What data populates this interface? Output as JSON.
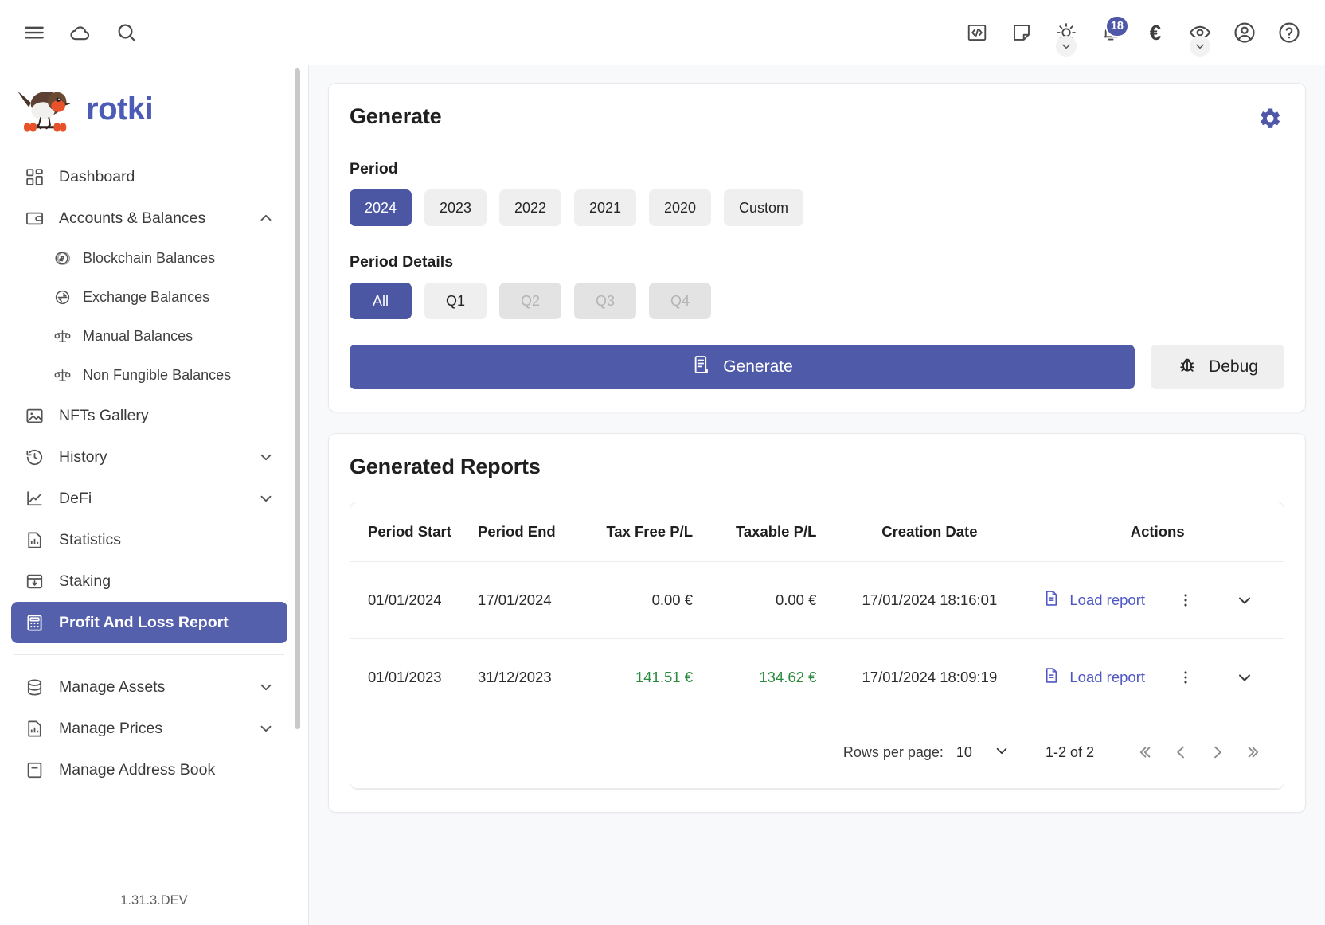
{
  "topbar": {
    "icons": [
      {
        "name": "menu-icon",
        "label": "Menu"
      },
      {
        "name": "cloud-icon",
        "label": "Cloud sync"
      },
      {
        "name": "search-icon",
        "label": "Search"
      }
    ],
    "right_icons": [
      {
        "name": "code-icon",
        "label": "Developer"
      },
      {
        "name": "note-icon",
        "label": "Notes"
      },
      {
        "name": "sun-icon",
        "label": "Theme"
      },
      {
        "name": "bell-icon",
        "label": "Notifications"
      },
      {
        "name": "euro-icon",
        "label": "Currency"
      },
      {
        "name": "eye-icon",
        "label": "Privacy mode"
      },
      {
        "name": "account-icon",
        "label": "Account"
      },
      {
        "name": "help-icon",
        "label": "Help"
      }
    ],
    "notification_count": "18",
    "currency_symbol": "€"
  },
  "brand": {
    "name": "rotki",
    "color": "#4c5bb5"
  },
  "sidebar": {
    "version": "1.31.3.DEV",
    "items": [
      {
        "label": "Dashboard",
        "icon": "dashboard-icon",
        "level": "top",
        "expandable": false,
        "active": false
      },
      {
        "label": "Accounts & Balances",
        "icon": "wallet-icon",
        "level": "top",
        "expandable": true,
        "expanded": true,
        "active": false
      },
      {
        "label": "Blockchain Balances",
        "icon": "coin-icon",
        "level": "sub",
        "expandable": false,
        "active": false
      },
      {
        "label": "Exchange Balances",
        "icon": "exchange-icon",
        "level": "sub",
        "expandable": false,
        "active": false
      },
      {
        "label": "Manual Balances",
        "icon": "scale-icon",
        "level": "sub",
        "expandable": false,
        "active": false
      },
      {
        "label": "Non Fungible Balances",
        "icon": "scale-icon",
        "level": "sub",
        "expandable": false,
        "active": false
      },
      {
        "label": "NFTs Gallery",
        "icon": "image-icon",
        "level": "top",
        "expandable": false,
        "active": false
      },
      {
        "label": "History",
        "icon": "history-icon",
        "level": "top",
        "expandable": true,
        "expanded": false,
        "active": false
      },
      {
        "label": "DeFi",
        "icon": "chart-line-icon",
        "level": "top",
        "expandable": true,
        "expanded": false,
        "active": false
      },
      {
        "label": "Statistics",
        "icon": "bar-chart-icon",
        "level": "top",
        "expandable": false,
        "active": false
      },
      {
        "label": "Staking",
        "icon": "staking-icon",
        "level": "top",
        "expandable": false,
        "active": false
      },
      {
        "label": "Profit And Loss Report",
        "icon": "calculator-icon",
        "level": "top",
        "expandable": false,
        "active": true
      },
      {
        "label": "Manage Assets",
        "icon": "database-icon",
        "level": "top",
        "expandable": true,
        "expanded": false,
        "active": false
      },
      {
        "label": "Manage Prices",
        "icon": "price-chart-icon",
        "level": "top",
        "expandable": true,
        "expanded": false,
        "active": false
      },
      {
        "label": "Manage Address Book",
        "icon": "address-book-icon",
        "level": "top",
        "expandable": false,
        "active": false
      }
    ]
  },
  "generate_card": {
    "title": "Generate",
    "settings_icon": "gear-icon",
    "period_label": "Period",
    "periods": [
      {
        "label": "2024",
        "active": true,
        "disabled": false
      },
      {
        "label": "2023",
        "active": false,
        "disabled": false
      },
      {
        "label": "2022",
        "active": false,
        "disabled": false
      },
      {
        "label": "2021",
        "active": false,
        "disabled": false
      },
      {
        "label": "2020",
        "active": false,
        "disabled": false
      },
      {
        "label": "Custom",
        "active": false,
        "disabled": false
      }
    ],
    "period_details_label": "Period Details",
    "period_details": [
      {
        "label": "All",
        "active": true,
        "disabled": false
      },
      {
        "label": "Q1",
        "active": false,
        "disabled": false
      },
      {
        "label": "Q2",
        "active": false,
        "disabled": true
      },
      {
        "label": "Q3",
        "active": false,
        "disabled": true
      },
      {
        "label": "Q4",
        "active": false,
        "disabled": true
      }
    ],
    "generate_button": "Generate",
    "debug_button": "Debug"
  },
  "reports_card": {
    "title": "Generated Reports",
    "columns": [
      "Period Start",
      "Period End",
      "Tax Free P/L",
      "Taxable P/L",
      "Creation Date",
      "Actions"
    ],
    "rows": [
      {
        "period_start": "01/01/2024",
        "period_end": "17/01/2024",
        "tax_free_pl": "0.00 €",
        "taxable_pl": "0.00 €",
        "tax_free_positive": false,
        "taxable_positive": false,
        "creation_date": "17/01/2024 18:16:01",
        "action_label": "Load report"
      },
      {
        "period_start": "01/01/2023",
        "period_end": "31/12/2023",
        "tax_free_pl": "141.51 €",
        "taxable_pl": "134.62 €",
        "tax_free_positive": true,
        "taxable_positive": true,
        "creation_date": "17/01/2024 18:09:19",
        "action_label": "Load report"
      }
    ],
    "pagination": {
      "rows_per_page_label": "Rows per page:",
      "rows_per_page_value": "10",
      "range_text": "1-2 of 2"
    }
  },
  "colors": {
    "accent": "#4f5aa8",
    "active_nav": "#5560ac",
    "link": "#4f57c4",
    "positive": "#2a8b3f",
    "canvas": "#f8f9fb"
  }
}
